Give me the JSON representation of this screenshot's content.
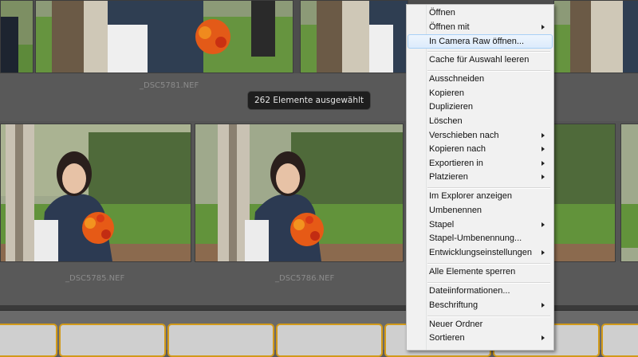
{
  "grid": {
    "labels": {
      "top_left": "_DSC5781.NEF",
      "mid_left": "_DSC5785.NEF",
      "mid_right": "_DSC5786.NEF"
    },
    "selection_toast": "262 Elemente ausgewählt"
  },
  "context_menu": {
    "items": {
      "open": "Öffnen",
      "open_with": "Öffnen mit",
      "open_camera_raw": "In Camera Raw öffnen...",
      "clear_cache": "Cache für Auswahl leeren",
      "cut": "Ausschneiden",
      "copy": "Kopieren",
      "duplicate": "Duplizieren",
      "delete": "Löschen",
      "move_to": "Verschieben nach",
      "copy_to": "Kopieren nach",
      "export_to": "Exportieren in",
      "place": "Platzieren",
      "show_in_explorer": "Im Explorer anzeigen",
      "rename": "Umbenennen",
      "stack": "Stapel",
      "batch_rename": "Stapel-Umbenennung...",
      "develop_settings": "Entwicklungseinstellungen",
      "lock_all": "Alle Elemente sperren",
      "file_info": "Dateiinformationen...",
      "label": "Beschriftung",
      "new_folder": "Neuer Ordner",
      "sort": "Sortieren"
    }
  },
  "colors": {
    "highlight": "#dcebfc",
    "filmstrip_border": "#d29a1a"
  }
}
